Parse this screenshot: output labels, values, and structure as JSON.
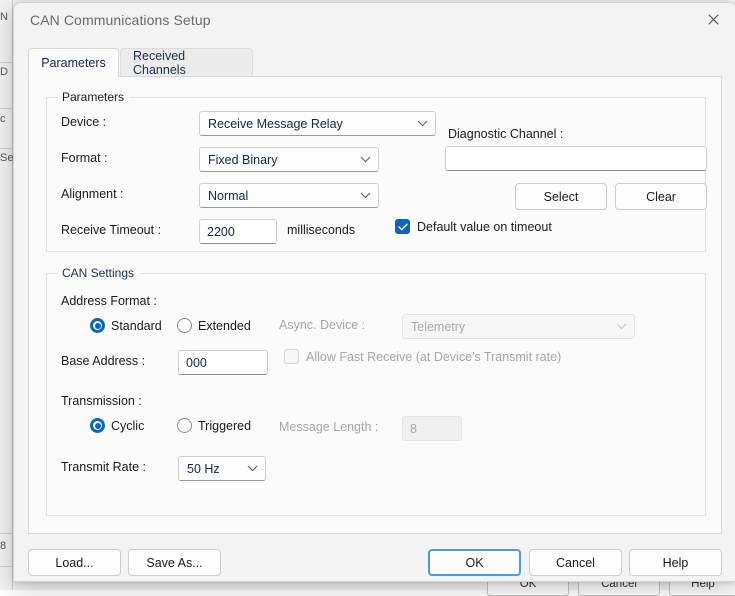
{
  "background_window": {
    "left_fragments": [
      "N",
      "D",
      "c",
      "Se",
      "8"
    ],
    "buttons": [
      {
        "label": "OK"
      },
      {
        "label": "Cancel"
      },
      {
        "label": "Help"
      }
    ]
  },
  "dialog": {
    "title": "CAN Communications Setup",
    "close_icon": "close-icon",
    "tabs": [
      {
        "label": "Parameters",
        "selected": true
      },
      {
        "label": "Received Channels",
        "selected": false
      }
    ],
    "parameters_group": {
      "title": "Parameters",
      "device_label": "Device :",
      "device_value": "Receive Message Relay",
      "format_label": "Format :",
      "format_value": "Fixed Binary",
      "alignment_label": "Alignment :",
      "alignment_value": "Normal",
      "receive_timeout_label": "Receive Timeout :",
      "receive_timeout_value": "2200",
      "receive_timeout_units": "milliseconds",
      "default_on_timeout_label": "Default value on timeout",
      "default_on_timeout_checked": true,
      "diagnostic_channel_label": "Diagnostic Channel :",
      "diagnostic_channel_value": "",
      "select_button": "Select",
      "clear_button": "Clear"
    },
    "can_settings_group": {
      "title": "CAN Settings",
      "address_format_label": "Address Format :",
      "address_standard_label": "Standard",
      "address_extended_label": "Extended",
      "address_format_selected": "Standard",
      "base_address_label": "Base Address :",
      "base_address_value": "000",
      "transmission_label": "Transmission :",
      "transmission_cyclic_label": "Cyclic",
      "transmission_triggered_label": "Triggered",
      "transmission_selected": "Cyclic",
      "transmit_rate_label": "Transmit Rate :",
      "transmit_rate_value": "50 Hz",
      "async_device_label": "Async. Device :",
      "async_device_value": "Telemetry",
      "async_device_enabled": false,
      "allow_fast_receive_label": "Allow Fast Receive (at Device's Transmit rate)",
      "allow_fast_receive_checked": false,
      "allow_fast_receive_enabled": false,
      "message_length_label": "Message Length :",
      "message_length_value": "8",
      "message_length_enabled": false
    },
    "footer": {
      "load_button": "Load...",
      "save_as_button": "Save As...",
      "ok_button": "OK",
      "cancel_button": "Cancel",
      "help_button": "Help"
    }
  },
  "colors": {
    "accent": "#0b66c3",
    "focus_border": "#4a9be0",
    "dialog_bg": "#f3f3f3",
    "page_bg": "#fbfbfb",
    "text": "#1b1b1b",
    "disabled_text": "#a6a6a6",
    "title_text": "#6a6a6a"
  }
}
